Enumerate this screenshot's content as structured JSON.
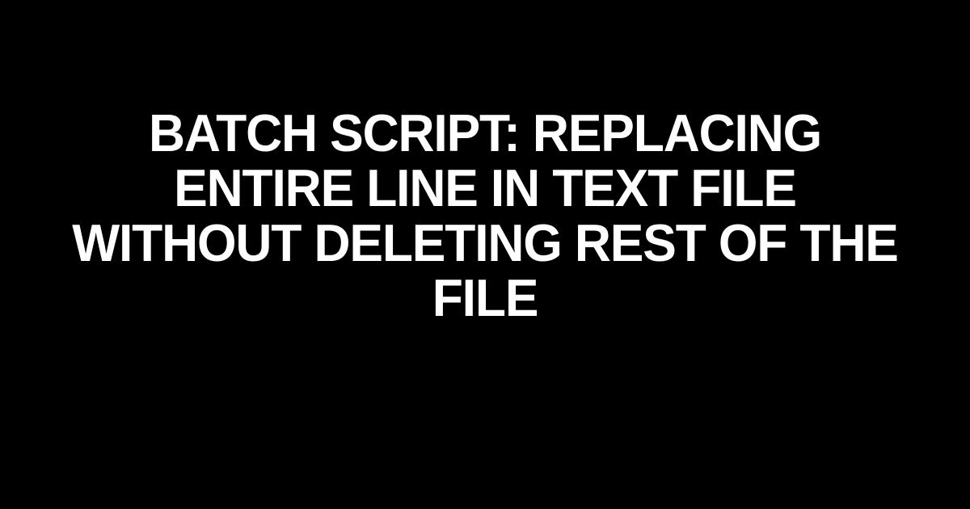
{
  "title": "BATCH SCRIPT: REPLACING ENTIRE LINE IN TEXT FILE WITHOUT DELETING REST OF THE FILE"
}
